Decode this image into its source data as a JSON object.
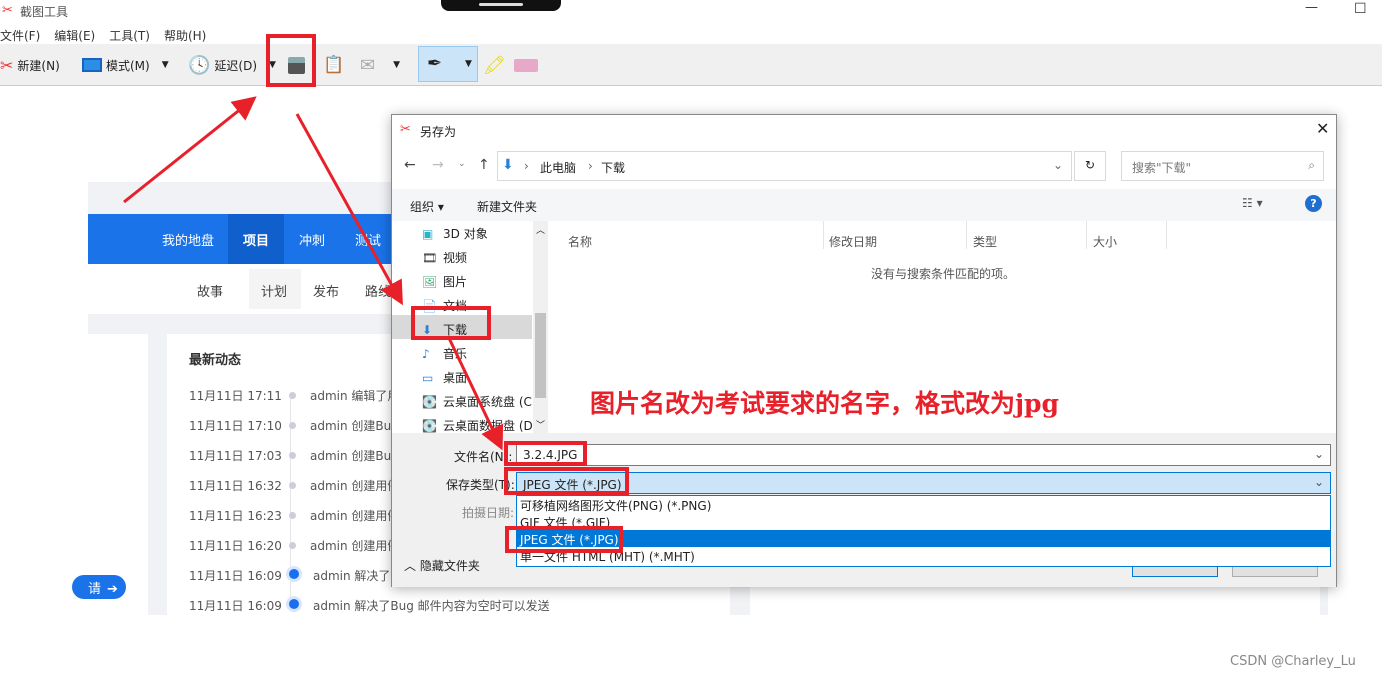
{
  "app": {
    "title": "截图工具",
    "menu": [
      "文件(F)",
      "编辑(E)",
      "工具(T)",
      "帮助(H)"
    ],
    "toolbar": {
      "new": "新建(N)",
      "mode": "模式(M)",
      "delay": "延迟(D)"
    }
  },
  "web": {
    "nav": [
      "我的地盘",
      "项目",
      "冲刺",
      "测试"
    ],
    "subnav": [
      "故事",
      "计划",
      "发布",
      "路线"
    ],
    "card_title": "最新动态",
    "button": "请",
    "activities": [
      {
        "time": "11月11日 17:11",
        "text": "admin 编辑了用"
      },
      {
        "time": "11月11日 17:10",
        "text": "admin 创建Bug"
      },
      {
        "time": "11月11日 17:03",
        "text": "admin 创建Bug"
      },
      {
        "time": "11月11日 16:32",
        "text": "admin 创建用例"
      },
      {
        "time": "11月11日 16:23",
        "text": "admin 创建用例"
      },
      {
        "time": "11月11日 16:20",
        "text": "admin 创建用例"
      },
      {
        "time": "11月11日 16:09",
        "text": "admin 解决了Bug"
      },
      {
        "time": "11月11日 16:09",
        "text": "admin 解决了Bug 邮件内容为空时可以发送"
      }
    ]
  },
  "dialog": {
    "title": "另存为",
    "path": [
      "此电脑",
      "下载"
    ],
    "search_placeholder": "搜索\"下载\"",
    "organize": "组织",
    "new_folder": "新建文件夹",
    "nav_items": [
      "3D 对象",
      "视频",
      "图片",
      "文档",
      "下载",
      "音乐",
      "桌面",
      "云桌面系统盘 (C",
      "云桌面数据盘 (D"
    ],
    "columns": [
      "名称",
      "修改日期",
      "类型",
      "大小"
    ],
    "empty": "没有与搜索条件匹配的项。",
    "filename_label": "文件名(N):",
    "filename": "3.2.4.JPG",
    "type_label": "保存类型(T):",
    "type": "JPEG 文件 (*.JPG)",
    "date_label": "拍摄日期:",
    "hide_folders": "隐藏文件夹",
    "options": [
      "可移植网络图形文件(PNG) (*.PNG)",
      "GIF 文件 (*.GIF)",
      "JPEG 文件 (*.JPG)",
      "单一文件 HTML (MHT) (*.MHT)"
    ],
    "selected_option": "JPEG 文件 (*.JPG)"
  },
  "annotation": "图片名改为考试要求的名字，格式改为jpg",
  "watermark": "CSDN @Charley_Lu",
  "colors": {
    "annotation": "#e8202a",
    "nav": "#1a73e8",
    "selection": "#0078d7"
  }
}
